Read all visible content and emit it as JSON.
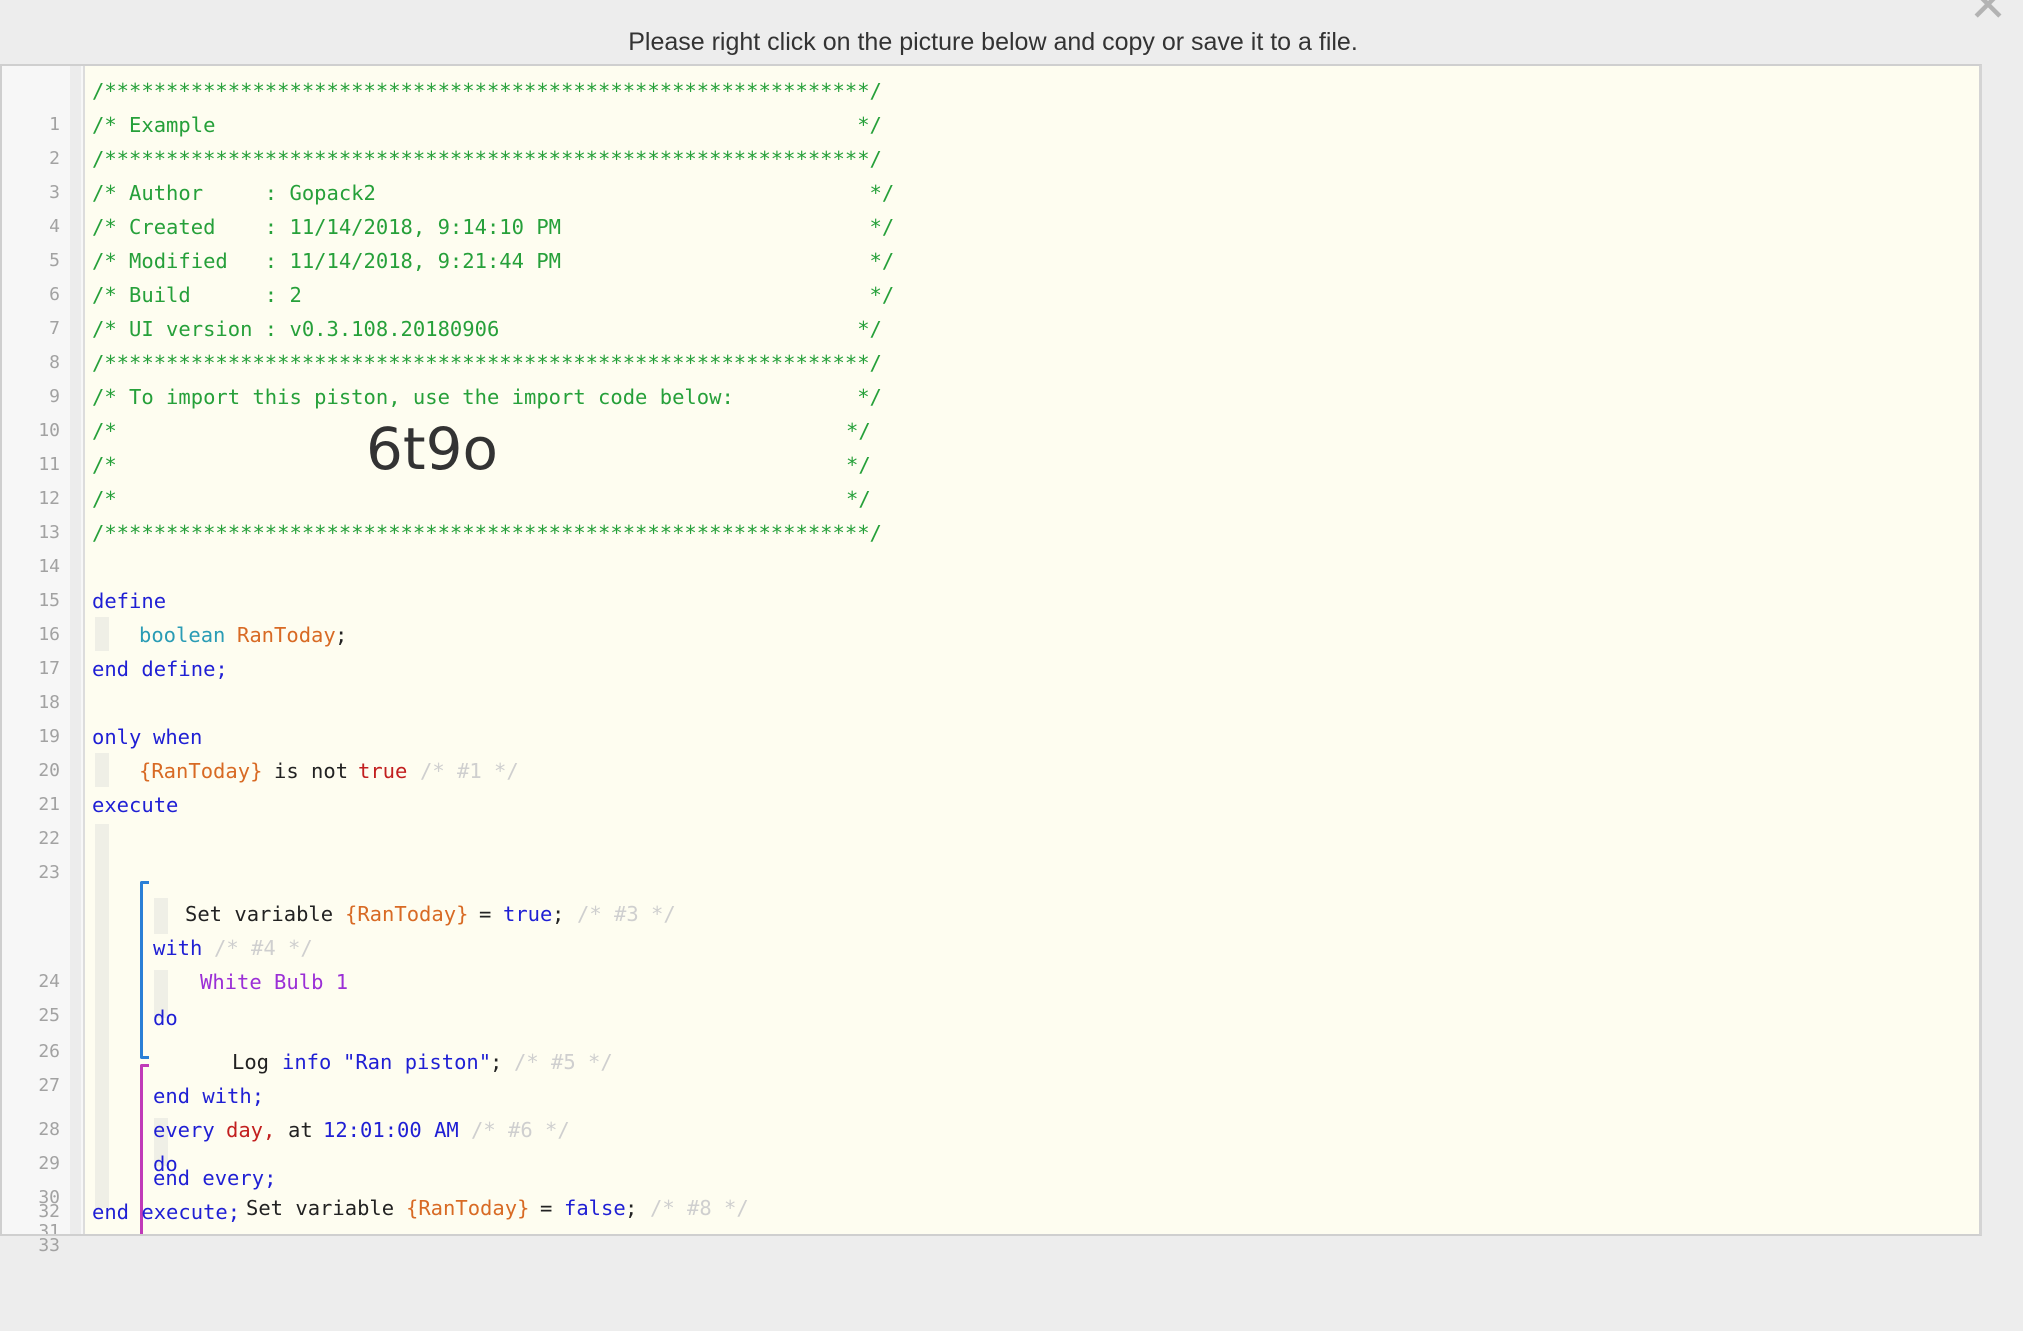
{
  "dialog": {
    "instruction": "Please right click on the picture below and copy or save it to a file.",
    "close_icon": "close-icon"
  },
  "piston": {
    "import_code": "6t9o",
    "lines": [
      {
        "n": "1"
      },
      {
        "n": "2"
      },
      {
        "n": "3"
      },
      {
        "n": "4"
      },
      {
        "n": "5"
      },
      {
        "n": "6"
      },
      {
        "n": "7"
      },
      {
        "n": "8"
      },
      {
        "n": "9"
      },
      {
        "n": "10"
      },
      {
        "n": "11"
      },
      {
        "n": "12"
      },
      {
        "n": "13"
      },
      {
        "n": "14"
      },
      {
        "n": "15"
      },
      {
        "n": "16"
      },
      {
        "n": "17"
      },
      {
        "n": "18"
      },
      {
        "n": "19"
      },
      {
        "n": "20"
      },
      {
        "n": "21"
      },
      {
        "n": "22"
      },
      {
        "n": "23"
      },
      {
        "n": "24"
      },
      {
        "n": "25"
      },
      {
        "n": "26"
      },
      {
        "n": "27"
      },
      {
        "n": "28"
      },
      {
        "n": "29"
      },
      {
        "n": "30"
      },
      {
        "n": "31"
      },
      {
        "n": "32"
      },
      {
        "n": "33"
      }
    ],
    "header": {
      "border": "/**************************************************************/",
      "example": "/* Example                                                    */",
      "author": "/* Author     : Gopack2                                        */",
      "created": "/* Created    : 11/14/2018, 9:14:10 PM                         */",
      "modified": "/* Modified   : 11/14/2018, 9:21:44 PM                         */",
      "build": "/* Build      : 2                                              */",
      "ui_version": "/* UI version : v0.3.108.20180906                             */",
      "import_hint": "/* To import this piston, use the import code below:          */",
      "blank_open": "/*",
      "blank_close": "*/"
    },
    "code": {
      "define": "define",
      "boolean": "boolean",
      "ran_today": "RanToday",
      "semicolon": ";",
      "end_define": "end define;",
      "only": "only",
      "when": "when",
      "ran_today_ref": "{RanToday}",
      "is_not": "is not",
      "true_kw": "true",
      "cm1": "/* #1 */",
      "execute": "execute",
      "set_variable": "Set variable",
      "equals": "=",
      "true_val": "true",
      "cm3": "/* #3 */",
      "with": "with",
      "cm4": "/* #4 */",
      "device": "White Bulb 1",
      "do": "do",
      "log": "Log",
      "info": "info",
      "log_msg": "\"Ran piston\"",
      "cm5": "/* #5 */",
      "end_with": "end with;",
      "every": "every",
      "day": "day,",
      "at": "at",
      "time": "12:01:00 AM",
      "cm6": "/* #6 */",
      "false_val": "false",
      "cm8": "/* #8 */",
      "end_every": "end every;",
      "end_execute": "end execute;"
    },
    "colors": {
      "background": "#fefdf0",
      "comment_header": "#26a03a",
      "keyword": "#1f1fd4",
      "variable": "#d86a24",
      "type": "#2a9cb5",
      "device": "#9b2fd6",
      "trigger_true": "#c21f1f",
      "with_bracket": "#2a7fd6",
      "every_bracket": "#c03ab8"
    }
  }
}
